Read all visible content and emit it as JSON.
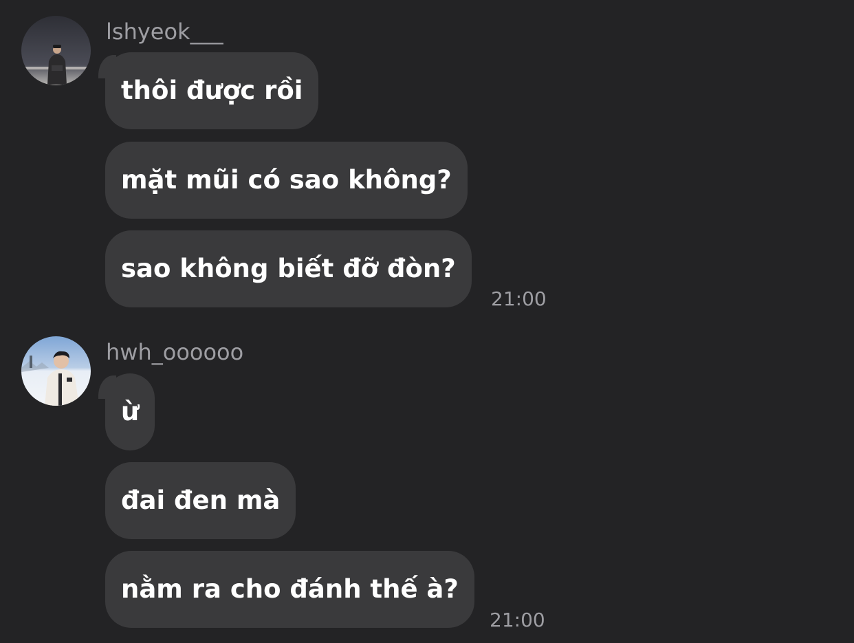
{
  "groups": [
    {
      "sender": "lshyeok___",
      "avatar_icon": "user-avatar-photo-night",
      "messages": [
        "thôi được rồi",
        "mặt mũi có sao không?",
        "sao không biết đỡ đòn?"
      ],
      "time": "21:00"
    },
    {
      "sender": "hwh_oooooo",
      "avatar_icon": "user-avatar-photo-snow",
      "messages": [
        "ừ",
        "đai đen mà",
        "nằm ra cho đánh thế à?"
      ],
      "time": "21:00"
    }
  ],
  "colors": {
    "background": "#232325",
    "bubble": "#3a3a3c",
    "message_text": "#ffffff",
    "secondary_text": "#9e9ea3"
  }
}
